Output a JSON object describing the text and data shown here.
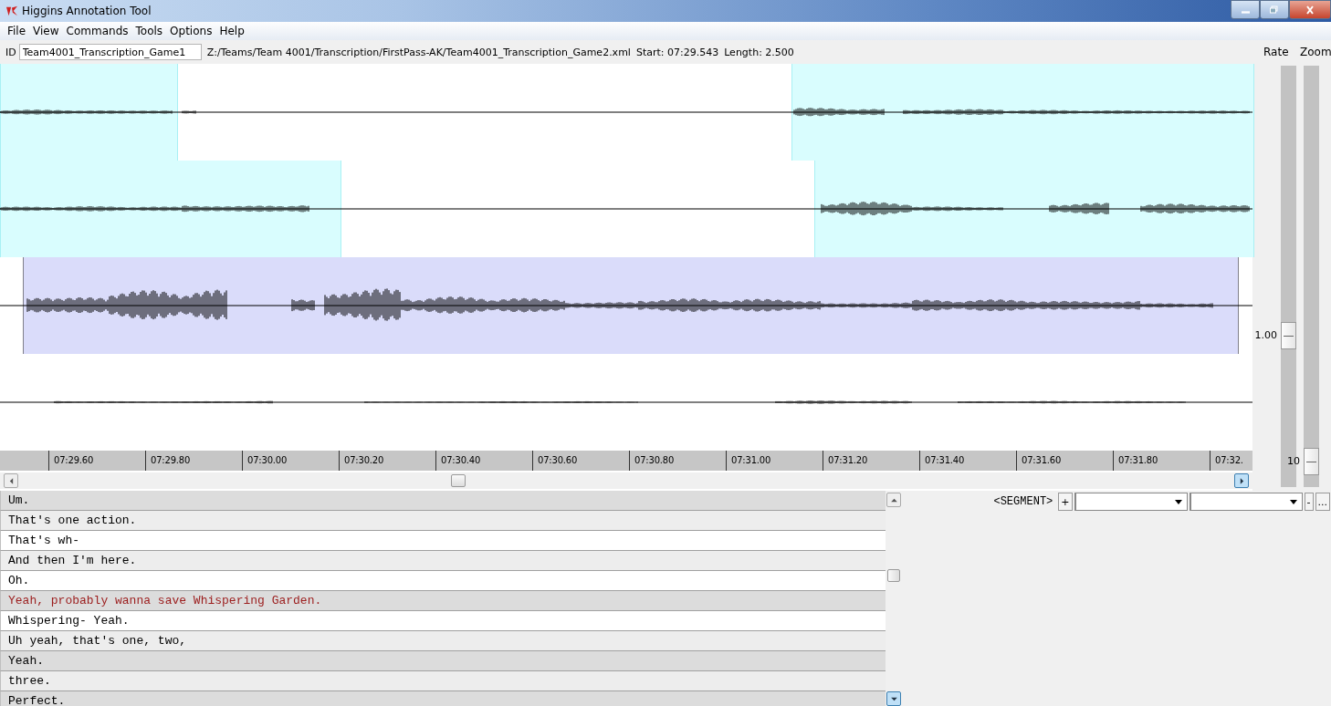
{
  "window": {
    "title": "Higgins Annotation Tool"
  },
  "menu": [
    "File",
    "View",
    "Commands",
    "Tools",
    "Options",
    "Help"
  ],
  "id_bar": {
    "label": "ID",
    "value": "Team4001_Transcription_Game1",
    "path": "Z:/Teams/Team 4001/Transcription/FirstPass-AK/Team4001_Transcription_Game2.xml",
    "start": "Start: 07:29.543",
    "length": "Length: 2.500"
  },
  "tracks": [
    {
      "segments": [
        {
          "selected": false
        },
        {
          "selected": false
        }
      ]
    },
    {
      "segments": [
        {
          "selected": false
        },
        {
          "selected": false
        }
      ]
    },
    {
      "segments": [
        {
          "selected": true
        }
      ]
    }
  ],
  "timeline": [
    "07:29.60",
    "07:29.80",
    "07:30.00",
    "07:30.20",
    "07:30.40",
    "07:30.60",
    "07:30.80",
    "07:31.00",
    "07:31.20",
    "07:31.40",
    "07:31.60",
    "07:31.80",
    "07:32."
  ],
  "sliders": [
    {
      "label": "Rate",
      "reading": "1.00",
      "level": 0.35
    },
    {
      "label": "Zoom",
      "reading": "10",
      "level": 0.03
    }
  ],
  "transcript": [
    {
      "text": "Um.",
      "kind": "dim",
      "selected": false
    },
    {
      "text": "That's one action.",
      "kind": "plain",
      "selected": false
    },
    {
      "text": "That's wh-",
      "kind": "open",
      "selected": false
    },
    {
      "text": "And then I'm here.",
      "kind": "plain",
      "selected": false
    },
    {
      "text": "Oh.",
      "kind": "open",
      "selected": false
    },
    {
      "text": "Yeah, probably wanna save Whispering Garden.",
      "kind": "dim",
      "selected": true
    },
    {
      "text": "Whispering- Yeah.",
      "kind": "open",
      "selected": false
    },
    {
      "text": "Uh yeah, that's one, two,",
      "kind": "plain",
      "selected": false
    },
    {
      "text": "Yeah.",
      "kind": "dim",
      "selected": false
    },
    {
      "text": "three.",
      "kind": "plain",
      "selected": false
    },
    {
      "text": "Perfect.",
      "kind": "dim",
      "selected": false
    }
  ],
  "segment_editor": {
    "label": "<SEGMENT>",
    "add": "+",
    "remove": "-",
    "more": "..."
  }
}
